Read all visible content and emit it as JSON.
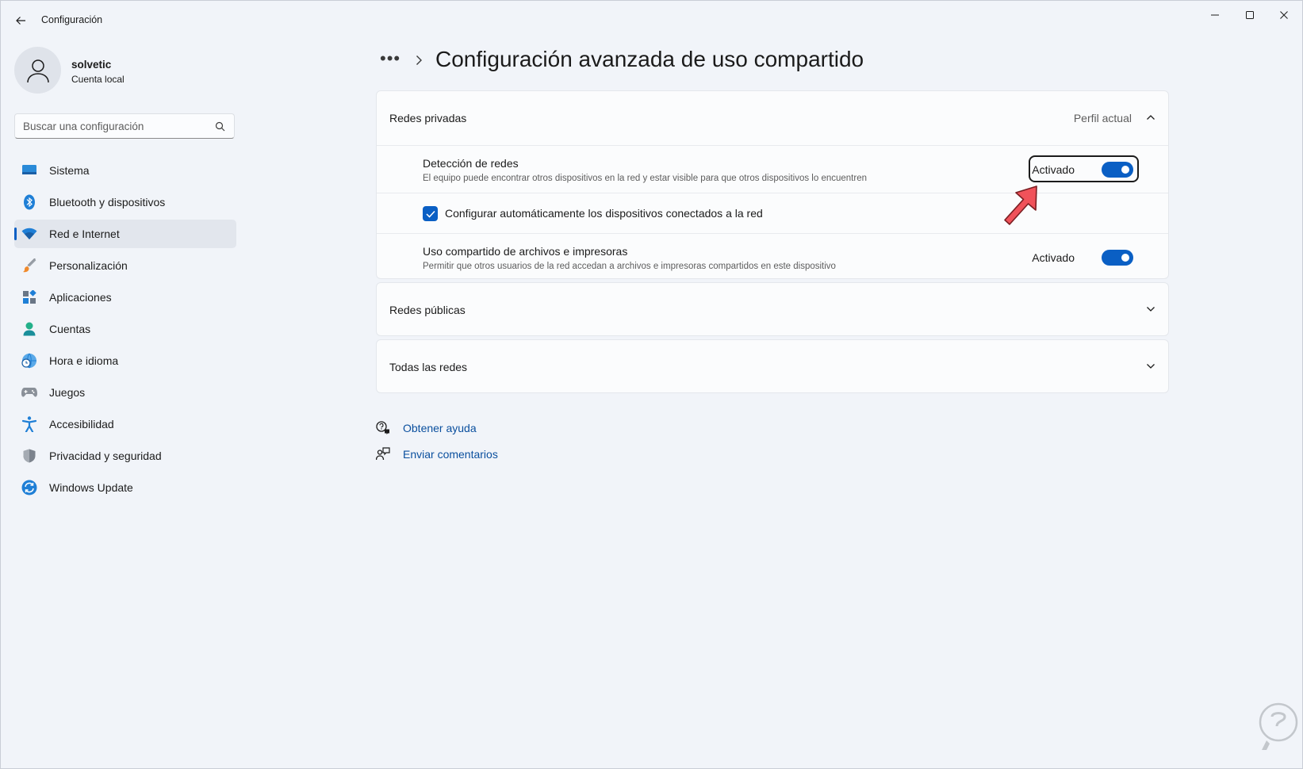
{
  "window": {
    "title": "Configuración"
  },
  "user": {
    "name": "solvetic",
    "account_type": "Cuenta local"
  },
  "search": {
    "placeholder": "Buscar una configuración"
  },
  "nav": {
    "items": [
      {
        "label": "Sistema",
        "icon": "monitor-icon"
      },
      {
        "label": "Bluetooth y dispositivos",
        "icon": "bluetooth-icon"
      },
      {
        "label": "Red e Internet",
        "icon": "wifi-icon",
        "active": true
      },
      {
        "label": "Personalización",
        "icon": "brush-icon"
      },
      {
        "label": "Aplicaciones",
        "icon": "apps-icon"
      },
      {
        "label": "Cuentas",
        "icon": "person-icon"
      },
      {
        "label": "Hora e idioma",
        "icon": "globe-clock-icon"
      },
      {
        "label": "Juegos",
        "icon": "gamepad-icon"
      },
      {
        "label": "Accesibilidad",
        "icon": "accessibility-icon"
      },
      {
        "label": "Privacidad y seguridad",
        "icon": "shield-icon"
      },
      {
        "label": "Windows Update",
        "icon": "update-icon"
      }
    ]
  },
  "breadcrumb": {
    "overflow": "•••",
    "current": "Configuración avanzada de uso compartido"
  },
  "private_networks": {
    "label": "Redes privadas",
    "badge": "Perfil actual",
    "expanded": true,
    "network_discovery": {
      "title": "Detección de redes",
      "description": "El equipo puede encontrar otros dispositivos en la red y estar visible para que otros dispositivos lo encuentren",
      "state": "Activado",
      "on": true
    },
    "auto_setup": {
      "label": "Configurar automáticamente los dispositivos conectados a la red",
      "checked": true
    },
    "file_sharing": {
      "title": "Uso compartido de archivos e impresoras",
      "description": "Permitir que otros usuarios de la red accedan a archivos e impresoras compartidos en este dispositivo",
      "state": "Activado",
      "on": true
    }
  },
  "public_networks": {
    "label": "Redes públicas",
    "expanded": false
  },
  "all_networks": {
    "label": "Todas las redes",
    "expanded": false
  },
  "help": {
    "get_help": "Obtener ayuda",
    "feedback": "Enviar comentarios"
  },
  "colors": {
    "accent": "#0a5fc4",
    "arrow": "#f0525a",
    "background": "#f1f4f9"
  }
}
